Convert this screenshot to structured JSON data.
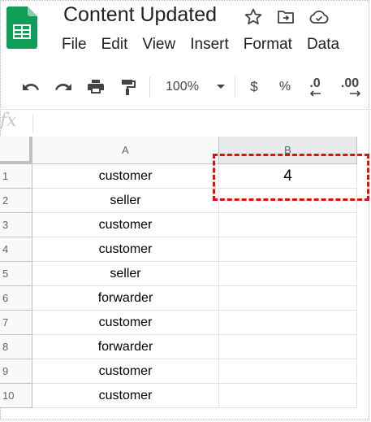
{
  "doc_title": "Content Updated",
  "menu": [
    "File",
    "Edit",
    "View",
    "Insert",
    "Format",
    "Data"
  ],
  "toolbar": {
    "zoom": "100%",
    "currency": "$",
    "percent": "%",
    "decimal_decrease": ".0",
    "decimal_increase": ".00"
  },
  "formula_bar": {
    "fx_label": "fx",
    "value": ""
  },
  "columns": [
    "A",
    "B"
  ],
  "rows": [
    {
      "num": "1",
      "a": "customer",
      "b": "4"
    },
    {
      "num": "2",
      "a": "seller",
      "b": ""
    },
    {
      "num": "3",
      "a": "customer",
      "b": ""
    },
    {
      "num": "4",
      "a": "customer",
      "b": ""
    },
    {
      "num": "5",
      "a": "seller",
      "b": ""
    },
    {
      "num": "6",
      "a": "forwarder",
      "b": ""
    },
    {
      "num": "7",
      "a": "customer",
      "b": ""
    },
    {
      "num": "8",
      "a": "forwarder",
      "b": ""
    },
    {
      "num": "9",
      "a": "customer",
      "b": ""
    },
    {
      "num": "10",
      "a": "customer",
      "b": ""
    }
  ],
  "colors": {
    "sheets_green": "#0f9d58",
    "highlight": "#e01010"
  }
}
